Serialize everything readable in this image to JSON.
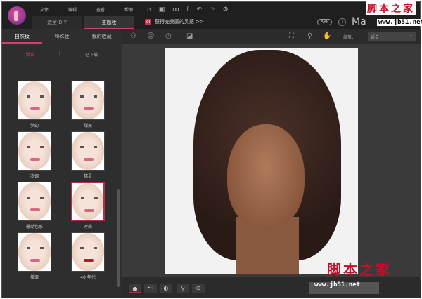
{
  "menu": [
    "文件",
    "编辑",
    "查看",
    "帮助"
  ],
  "tabs": [
    "造型 DIY",
    "主题妆"
  ],
  "banner": "获得完美圆的灵感 >>",
  "banner_icon": "ol",
  "app_label": "APP",
  "info_label": "i",
  "brand": "Ma",
  "toolbar_icons": [
    "home-icon",
    "save-icon",
    "share-icon",
    "facebook-icon",
    "undo-icon",
    "redo-icon",
    "settings-icon"
  ],
  "side": {
    "subtabs": [
      "自然妆",
      "特殊妆",
      "我的收藏"
    ],
    "filters": [
      "默认",
      "|",
      "已下载"
    ],
    "items": [
      {
        "label": "梦幻"
      },
      {
        "label": "甜美"
      },
      {
        "label": "冷调"
      },
      {
        "label": "精灵"
      },
      {
        "label": "珊瑚色系"
      },
      {
        "label": "时尚",
        "selected": true
      },
      {
        "label": "摇滚"
      },
      {
        "label": "40 年代"
      }
    ]
  },
  "view": {
    "zoom_label": "缩放：",
    "zoom_value": "适合"
  },
  "watermark": {
    "title": "脚本之家",
    "url": "www.jb51.net"
  },
  "colors": {
    "accent": "#d04070",
    "bg": "#2b2b2b"
  }
}
